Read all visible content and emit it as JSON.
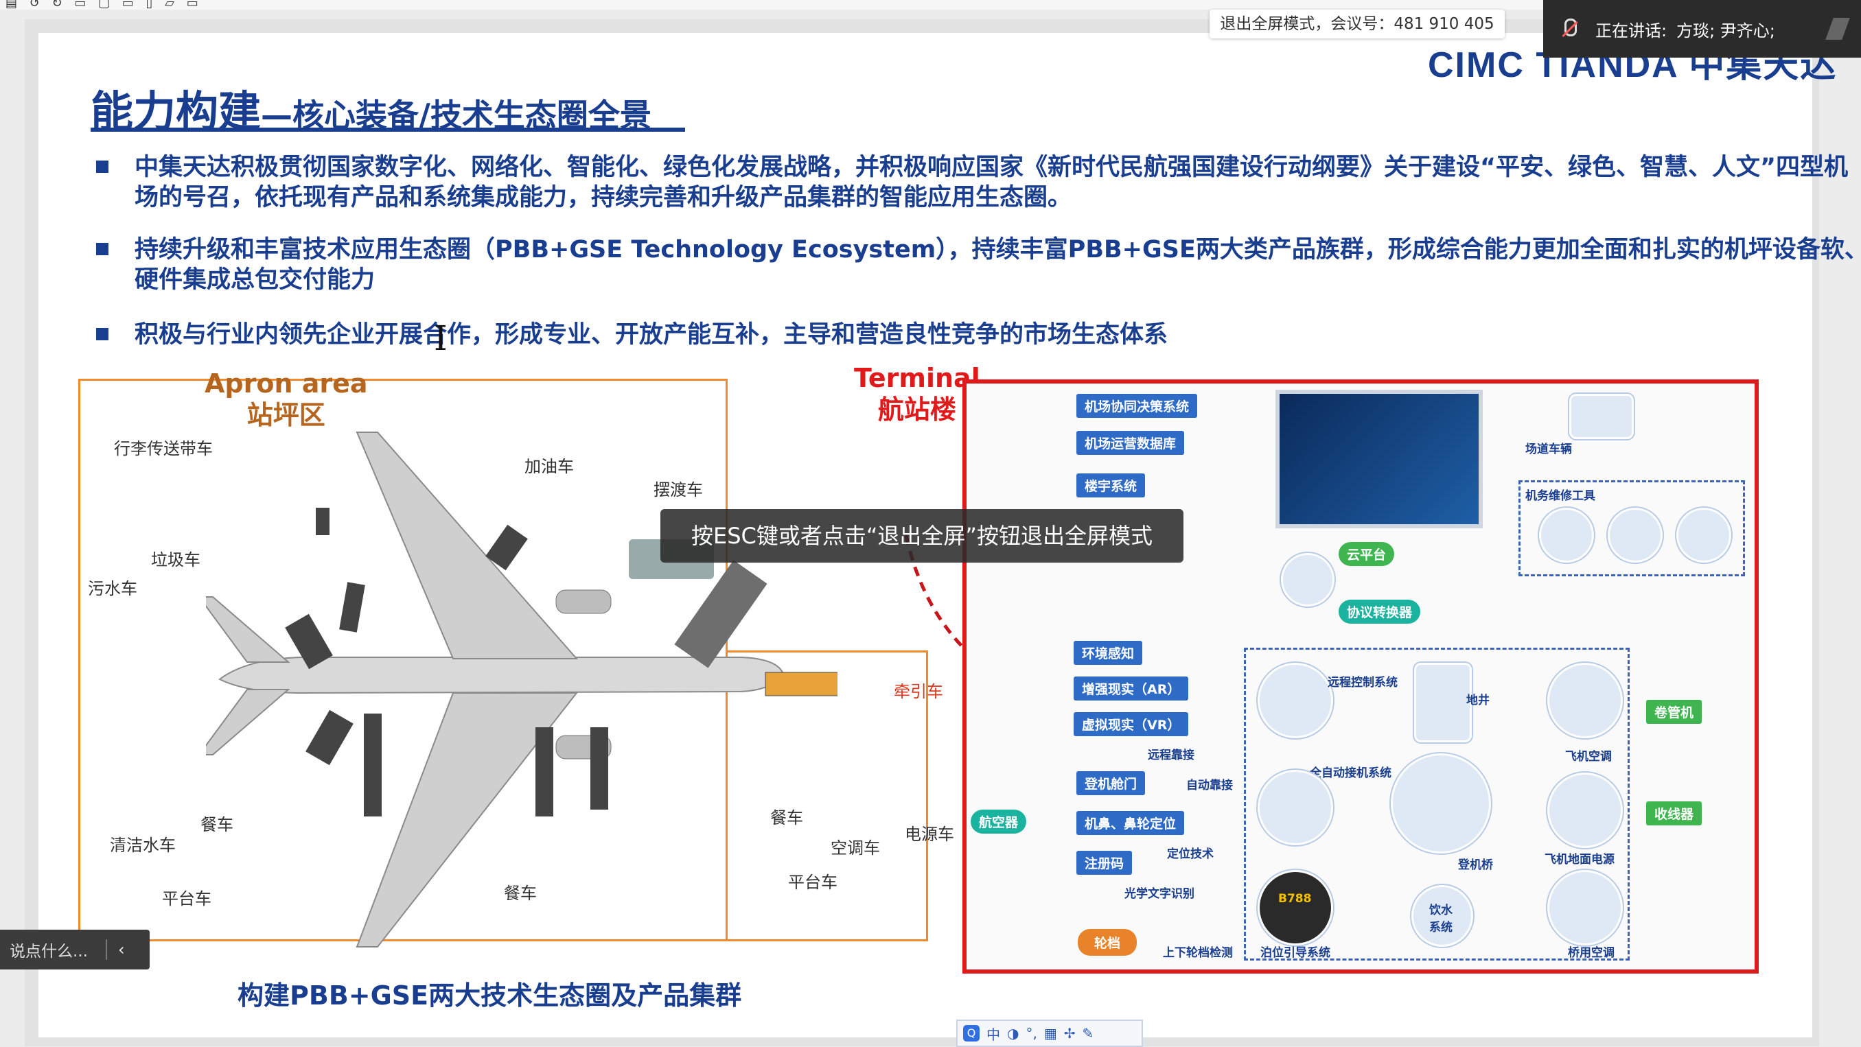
{
  "meeting": {
    "exit_fullscreen_tip": "退出全屏模式，会议号：481 910 405",
    "speaking_label": "正在讲话:",
    "speakers": "方琰; 尹齐心;",
    "esc_toast": "按ESC键或者点击“退出全屏”按钮退出全屏模式",
    "chat_placeholder": "说点什么...",
    "collapse_icon_glyph": "‹",
    "ime_items": [
      "中",
      "◑",
      "°,",
      "▦",
      "✢",
      "✎"
    ]
  },
  "slide": {
    "logo": "CIMC TIANDA 中集天达",
    "title_main": "能力构建",
    "title_sub": "—核心装备/技术生态圈全景",
    "bullets": [
      "中集天达积极贯彻国家数字化、网络化、智能化、绿色化发展战略，并积极响应国家《新时代民航强国建设行动纲要》关于建设“平安、绿色、智慧、人文”四型机场的号召，依托现有产品和系统集成能力，持续完善和升级产品集群的智能应用生态圈。",
      "持续升级和丰富技术应用生态圈（PBB+GSE Technology Ecosystem），持续丰富PBB+GSE两大类产品族群，形成综合能力更加全面和扎实的机坪设备软、硬件集成总包交付能力",
      "积极与行业内领先企业开展合作，形成专业、开放产能互补，主导和营造良性竞争的市场生态体系"
    ],
    "apron_title_en": "Apron area",
    "apron_title_cn": "站坪区",
    "terminal_title_en": "Terminal",
    "terminal_title_cn": "航站楼",
    "apron_labels": {
      "baggage": "行李传送带车",
      "fuel": "加油车",
      "shuttle": "摆渡车",
      "garbage": "垃圾车",
      "sewage": "污水车",
      "tug": "牵引车",
      "catering1": "餐车",
      "catering2": "餐车",
      "catering3": "餐车",
      "cleanwater": "清洁水车",
      "platform1": "平台车",
      "platform2": "平台车",
      "aircon": "空调车",
      "power": "电源车"
    },
    "terminal_labels": {
      "cdm": "机场协同决策系统",
      "db": "机场运营数据库",
      "bms": "楼宇系统",
      "field_vehicle": "场道车辆",
      "maint_tools": "机务维修工具",
      "cloud": "云平台",
      "protocol": "协议转换器",
      "env": "环境感知",
      "ar": "增强现实（AR）",
      "vr": "虚拟现实（VR）",
      "remote_ctrl": "远程控制系统",
      "pit": "地井",
      "hose": "卷管机",
      "aircon": "飞机空调",
      "auto_dock": "全自动接机系统",
      "remote_dock": "远程靠接",
      "auto_dock2": "自动靠接",
      "door": "登机舱门",
      "nose": "机鼻、鼻轮定位",
      "position_tech": "定位技术",
      "reg": "注册码",
      "ocr": "光学文字识别",
      "aircraft": "航空器",
      "bridge": "登机桥",
      "gpu": "飞机地面电源",
      "cable": "收线器",
      "water": "饮水系统",
      "vdgs": "泊位引导系统",
      "chock": "轮档",
      "chock_detect": "上下轮档检测",
      "bridge_ac": "桥用空调",
      "b788": "B788"
    },
    "caption": "构建PBB+GSE两大技术生态圈及产品集群"
  }
}
